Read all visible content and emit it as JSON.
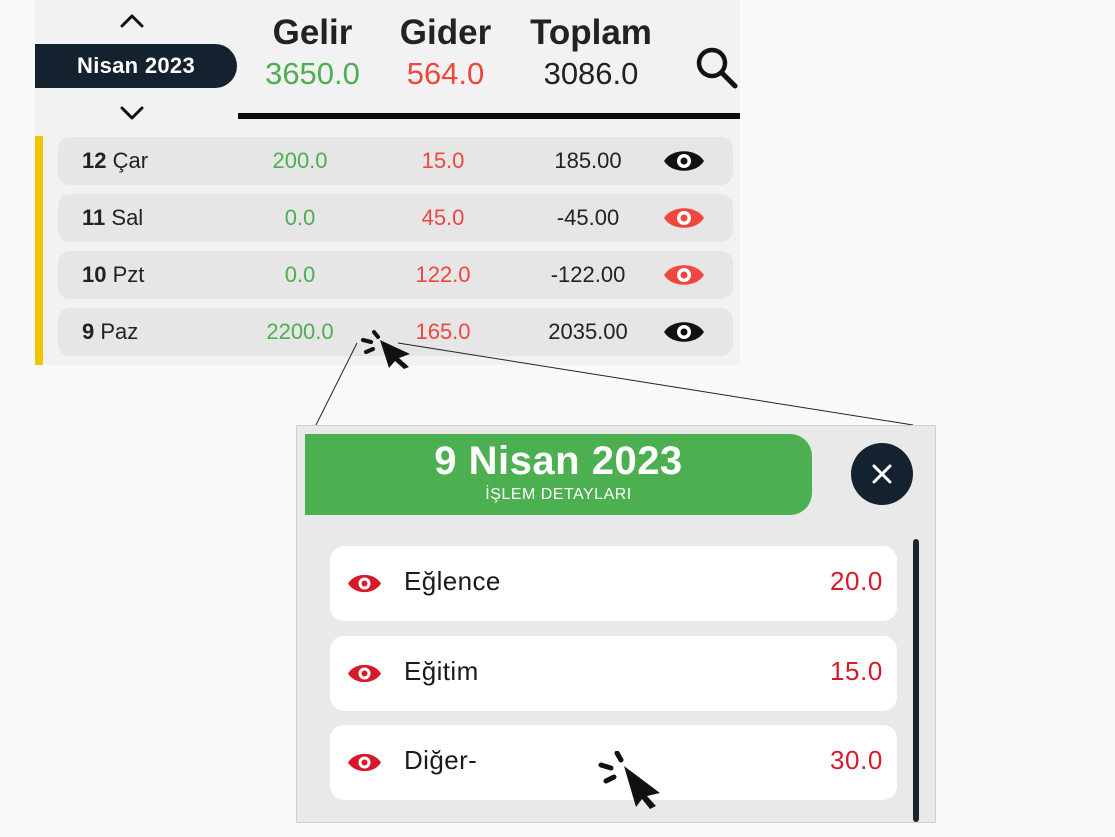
{
  "month_nav": {
    "label": "Nisan 2023",
    "prev_icon": "chevron-up-icon",
    "next_icon": "chevron-down-icon"
  },
  "summary": {
    "income_label": "Gelir",
    "income_value": "3650.0",
    "expense_label": "Gider",
    "expense_value": "564.0",
    "total_label": "Toplam",
    "total_value": "3086.0",
    "search_icon": "search-icon"
  },
  "days": [
    {
      "num": "12",
      "dow": "Çar",
      "income": "200.0",
      "expense": "15.0",
      "total": "185.00",
      "eye_color": "#111111"
    },
    {
      "num": "11",
      "dow": "Sal",
      "income": "0.0",
      "expense": "45.0",
      "total": "-45.00",
      "eye_color": "#f0463d"
    },
    {
      "num": "10",
      "dow": "Pzt",
      "income": "0.0",
      "expense": "122.0",
      "total": "-122.00",
      "eye_color": "#f0463d"
    },
    {
      "num": "9",
      "dow": "Paz",
      "income": "2200.0",
      "expense": "165.0",
      "total": "2035.00",
      "eye_color": "#111111"
    }
  ],
  "detail": {
    "date": "9 Nisan 2023",
    "subtitle": "İŞLEM DETAYLARI",
    "close_icon": "close-icon",
    "items": [
      {
        "name": "Eğlence",
        "amount": "20.0"
      },
      {
        "name": "Eğitim",
        "amount": "15.0"
      },
      {
        "name": "Diğer-",
        "amount": "30.0"
      }
    ]
  },
  "colors": {
    "income": "#4caf50",
    "expense": "#f0463d",
    "detail_amount": "#d7192a",
    "header_green": "#4caf50",
    "navy": "#142230",
    "accent_yellow": "#f2c500"
  }
}
